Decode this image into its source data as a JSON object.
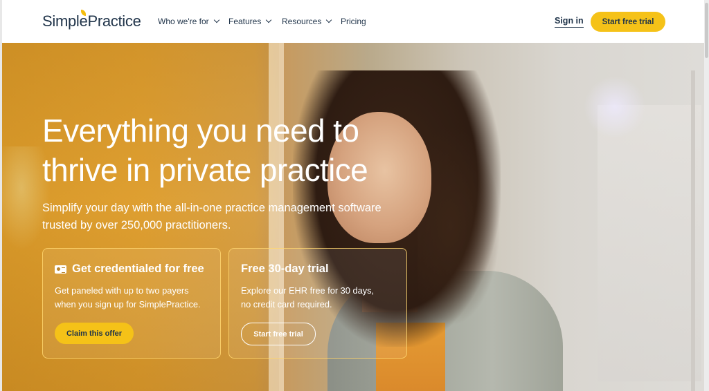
{
  "header": {
    "logo": "SimplePractice",
    "nav": [
      {
        "label": "Who we're for",
        "has_dropdown": true
      },
      {
        "label": "Features",
        "has_dropdown": true
      },
      {
        "label": "Resources",
        "has_dropdown": true
      },
      {
        "label": "Pricing",
        "has_dropdown": false
      }
    ],
    "sign_in": "Sign in",
    "cta": "Start free trial"
  },
  "hero": {
    "title_line1": "Everything you need to",
    "title_line2": "thrive in private practice",
    "subtitle_line1": "Simplify your day with the all-in-one practice management software",
    "subtitle_line2": "trusted by over 250,000 practitioners.",
    "cards": [
      {
        "icon": "id-card-icon",
        "title": "Get credentialed for free",
        "text_line1": "Get paneled with up to two payers",
        "text_line2": "when you sign up for SimplePractice.",
        "button": "Claim this offer"
      },
      {
        "title": "Free 30-day trial",
        "text_line1": "Explore our EHR free for 30 days,",
        "text_line2": "no credit card required.",
        "button": "Start free trial"
      }
    ]
  },
  "colors": {
    "brand_navy": "#1f3349",
    "accent_yellow": "#f5c218",
    "hero_amber": "#e0a132"
  }
}
